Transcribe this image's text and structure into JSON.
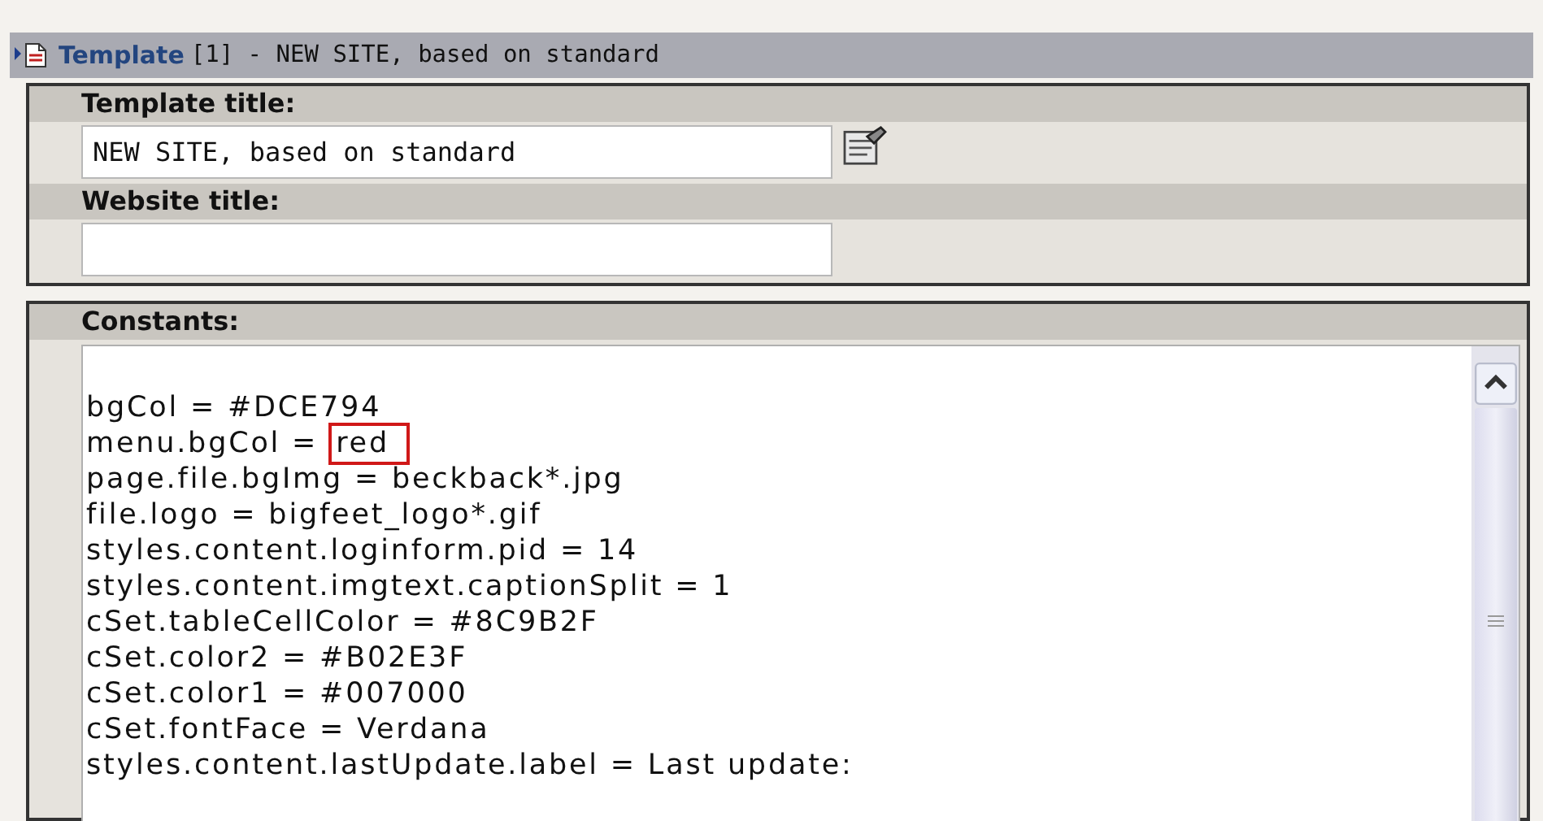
{
  "header": {
    "link": "Template",
    "text": "[1] - NEW SITE, based on standard"
  },
  "fields": [
    {
      "label": "Template title:",
      "value": "NEW SITE, based on standard",
      "kind": "picker"
    },
    {
      "label": "Website title:",
      "kind": "plain"
    }
  ],
  "constants": {
    "label": "Constants:",
    "lines": [
      {
        "text": "bgCol = #DCE794"
      },
      {
        "text": "menu.bgCol = ",
        "highlight": "red"
      },
      {
        "text": "page.file.bgImg = beckback*.jpg"
      },
      {
        "text": "file.logo = bigfeet_logo*.gif"
      },
      {
        "text": "styles.content.loginform.pid = 14"
      },
      {
        "text": "styles.content.imgtext.captionSplit = 1"
      },
      {
        "text": "cSet.tableCellColor = #8C9B2F"
      },
      {
        "text": "cSet.color2 = #B02E3F"
      },
      {
        "text": "cSet.color1 = #007000"
      },
      {
        "text": "cSet.fontFace = Verdana"
      },
      {
        "text": "styles.content.lastUpdate.label = Last update:"
      }
    ]
  }
}
